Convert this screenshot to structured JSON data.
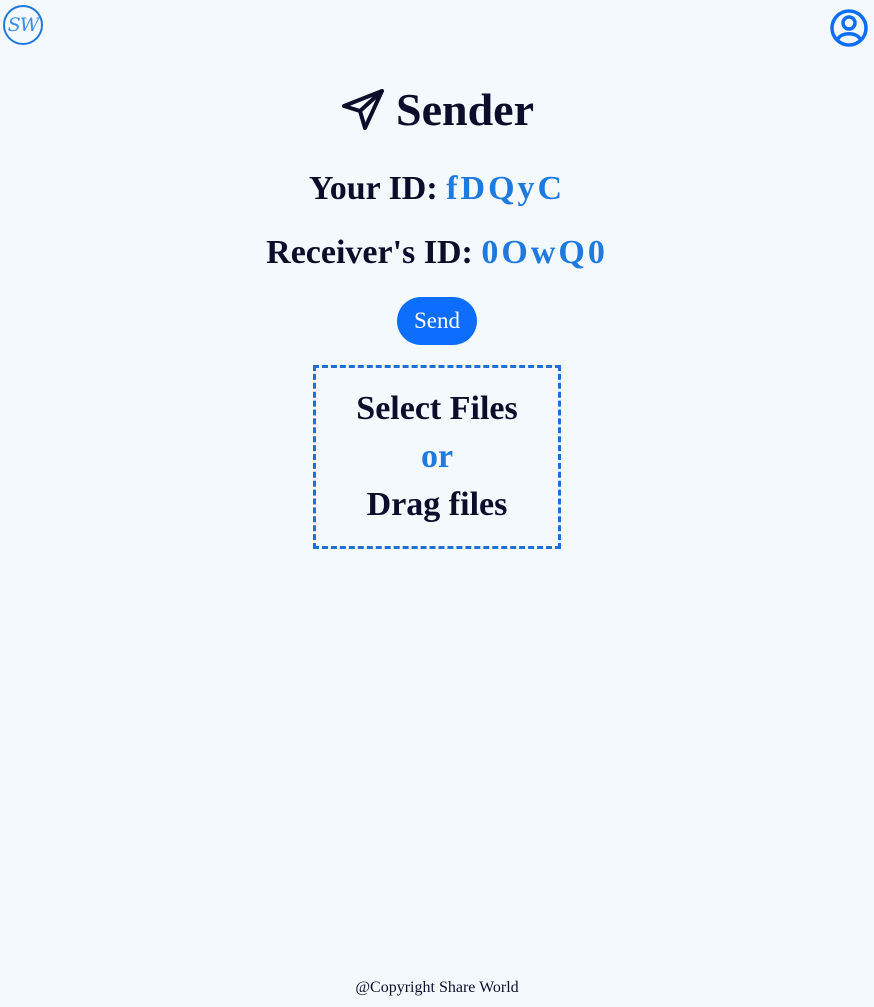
{
  "header": {
    "logo_text": "SW",
    "profile_icon": "user-circle-icon"
  },
  "main": {
    "title": "Sender",
    "title_icon": "paper-plane-icon",
    "your_id_label": "Your ID:",
    "your_id_value": "fDQyC",
    "receiver_id_label": "Receiver's ID:",
    "receiver_id_value": "0OwQ0",
    "send_label": "Send",
    "dropzone": {
      "select_label": "Select Files",
      "or_label": "or",
      "drag_label": "Drag files"
    }
  },
  "footer": {
    "copyright": "@Copyright Share World"
  },
  "colors": {
    "accent": "#1f7ae0",
    "button": "#0d6efd",
    "background": "#f4f9fe",
    "text": "#0d0d2b"
  }
}
